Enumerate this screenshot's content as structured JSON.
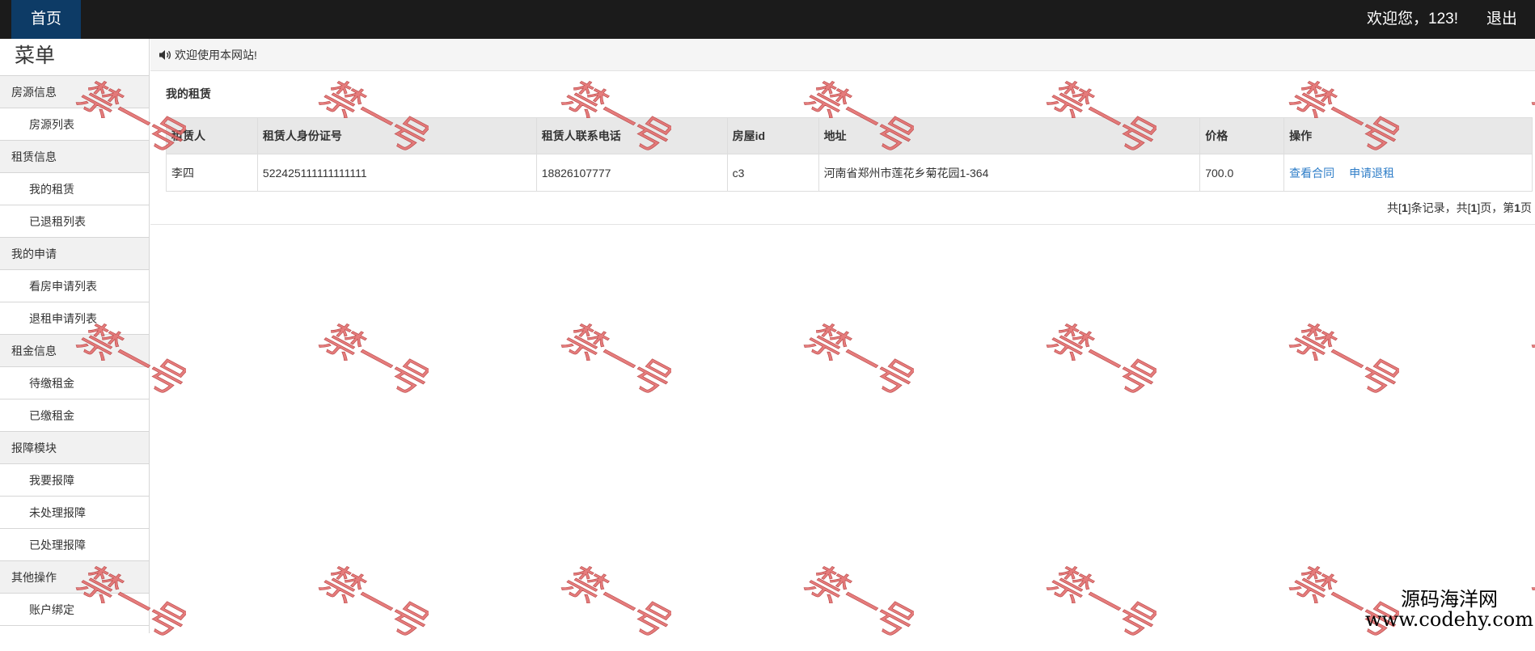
{
  "navbar": {
    "home_label": "首页",
    "welcome_text": "欢迎您，123!",
    "logout_label": "退出"
  },
  "sidebar": {
    "title": "菜单",
    "groups": [
      {
        "label": "房源信息",
        "items": [
          {
            "label": "房源列表"
          }
        ]
      },
      {
        "label": "租赁信息",
        "items": [
          {
            "label": "我的租赁"
          },
          {
            "label": "已退租列表"
          }
        ]
      },
      {
        "label": "我的申请",
        "items": [
          {
            "label": "看房申请列表"
          },
          {
            "label": "退租申请列表"
          }
        ]
      },
      {
        "label": "租金信息",
        "items": [
          {
            "label": "待缴租金"
          },
          {
            "label": "已缴租金"
          }
        ]
      },
      {
        "label": "报障模块",
        "items": [
          {
            "label": "我要报障"
          },
          {
            "label": "未处理报障"
          },
          {
            "label": "已处理报障"
          }
        ]
      },
      {
        "label": "其他操作",
        "items": [
          {
            "label": "账户绑定"
          }
        ]
      }
    ]
  },
  "notice": {
    "icon": "speaker-icon",
    "text": "欢迎使用本网站!"
  },
  "main": {
    "section_title": "我的租赁",
    "table": {
      "headers": [
        "租赁人",
        "租赁人身份证号",
        "租赁人联系电话",
        "房屋id",
        "地址",
        "价格",
        "操作"
      ],
      "rows": [
        {
          "tenant": "李四",
          "id_number": "522425111111111111",
          "phone": "18826107777",
          "house_id": "c3",
          "address": "河南省郑州市莲花乡菊花园1-364",
          "price": "700.0",
          "actions": [
            "查看合同",
            "申请退租"
          ]
        }
      ]
    },
    "pagination": {
      "prefix": "共[",
      "total_records": "1",
      "mid1": "]条记录，共[",
      "total_pages": "1",
      "mid2": "]页，第",
      "current_page": "1",
      "suffix": "页"
    }
  },
  "watermark": {
    "stamp_text": "禁一号",
    "stamp_color": "#e06565",
    "corner_cn": "源码海洋网",
    "corner_url": "www.codehy.com"
  }
}
